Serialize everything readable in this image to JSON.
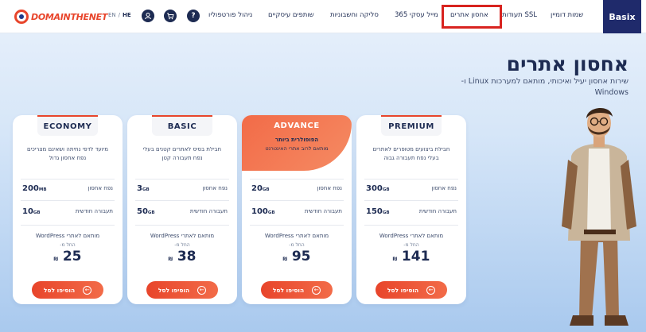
{
  "header": {
    "logo_text": "DOMAINTHENET",
    "lang": {
      "en": "EN",
      "sep": "/",
      "he": "HE"
    },
    "icons": {
      "account": "user-circle-icon",
      "cart": "cart-icon",
      "help": "?"
    },
    "nav": [
      "ניהול פורטפוליו",
      "שותפים עיסקיים",
      "סליקה וחשבוניות",
      "מייל עסקי 365",
      "תעודות SSL",
      "אחסון אתרים",
      "שמות דומיין"
    ],
    "brand_badge": "Basix"
  },
  "hero": {
    "title": "אחסון אתרים",
    "subtitle": "שירות אחסון יעיל ואיכותי, מותאם למערכות Linux ו- Windows"
  },
  "plans": [
    {
      "name": "ECONOMY",
      "desc": "מיועד לדפי נחיתה ושאינם מצריכים נפח אחסון גדול",
      "storage": "200",
      "storage_unit": "MB",
      "storage_label": "נפח אחסון",
      "traffic": "10",
      "traffic_unit": "GB",
      "traffic_label": "תעבורה חודשית",
      "wp": "מותאם לאתרי WordPress",
      "from": "החל מ-",
      "price": "25",
      "currency": "₪",
      "button": "הוסיפו לסל"
    },
    {
      "name": "BASIC",
      "desc": "חבילת בסיס לאתרים קטנים בעלי נפח תעבורה קטן",
      "storage": "3",
      "storage_unit": "GB",
      "storage_label": "נפח אחסון",
      "traffic": "50",
      "traffic_unit": "GB",
      "traffic_label": "תעבורה חודשית",
      "wp": "מותאם לאתרי WordPress",
      "from": "החל מ-",
      "price": "38",
      "currency": "₪",
      "button": "הוסיפו לסל"
    },
    {
      "name": "ADVANCE",
      "featured_line1": "הפופולרית ביותר",
      "featured_line2": "מותאם לרוב אתרי האינטרנט",
      "storage": "20",
      "storage_unit": "GB",
      "storage_label": "נפח אחסון",
      "traffic": "100",
      "traffic_unit": "GB",
      "traffic_label": "תעבורה חודשית",
      "wp": "מותאם לאתרי WordPress",
      "from": "החל מ-",
      "price": "95",
      "currency": "₪",
      "button": "הוסיפו לסל"
    },
    {
      "name": "PREMIUM",
      "desc": "חבילת ביצועים מטופרים לאתרים בעלי נפח תעבורה גבוה",
      "storage": "300",
      "storage_unit": "GB",
      "storage_label": "נפח אחסון",
      "traffic": "150",
      "traffic_unit": "GB",
      "traffic_label": "תעבורה חודשית",
      "wp": "מותאם לאתרי WordPress",
      "from": "החל מ-",
      "price": "141",
      "currency": "₪",
      "button": "הוסיפו לסל"
    }
  ],
  "colors": {
    "accent": "#e8452b",
    "navy": "#1d2b52",
    "brand_badge_bg": "#1f2a6b",
    "highlight_box": "#d8231f"
  }
}
